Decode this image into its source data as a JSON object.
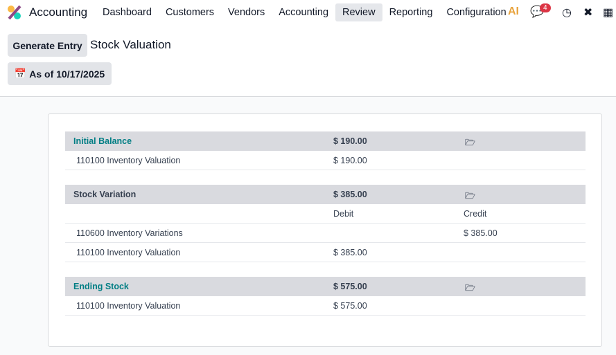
{
  "nav": {
    "app": "Accounting",
    "menu": [
      "Dashboard",
      "Customers",
      "Vendors",
      "Accounting",
      "Review",
      "Reporting",
      "Configuration"
    ],
    "active": "Review",
    "ai_label": "AI",
    "messages_badge": "4",
    "icons": [
      "app-logo-icon",
      "ai-icon",
      "chat-icon",
      "clock-icon",
      "tools-icon",
      "building-icon"
    ]
  },
  "toolbar": {
    "generate": "Generate Entry",
    "title": "Stock Valuation",
    "date_filter": "As of 10/17/2025"
  },
  "report": {
    "initial": {
      "label": "Initial Balance",
      "amount": "$ 190.00",
      "lines": [
        {
          "account": "110100 Inventory Valuation",
          "amount": "$ 190.00"
        }
      ]
    },
    "variation": {
      "label": "Stock Variation",
      "amount": "$ 385.00",
      "debit_header": "Debit",
      "credit_header": "Credit",
      "lines": [
        {
          "account": "110600 Inventory Variations",
          "debit": "",
          "credit": "$ 385.00"
        },
        {
          "account": "110100 Inventory Valuation",
          "debit": "$ 385.00",
          "credit": ""
        }
      ]
    },
    "ending": {
      "label": "Ending Stock",
      "amount": "$ 575.00",
      "lines": [
        {
          "account": "110100 Inventory Valuation",
          "amount": "$ 575.00"
        }
      ]
    }
  },
  "colors": {
    "accent": "#017e84",
    "badge": "#dc3545"
  }
}
